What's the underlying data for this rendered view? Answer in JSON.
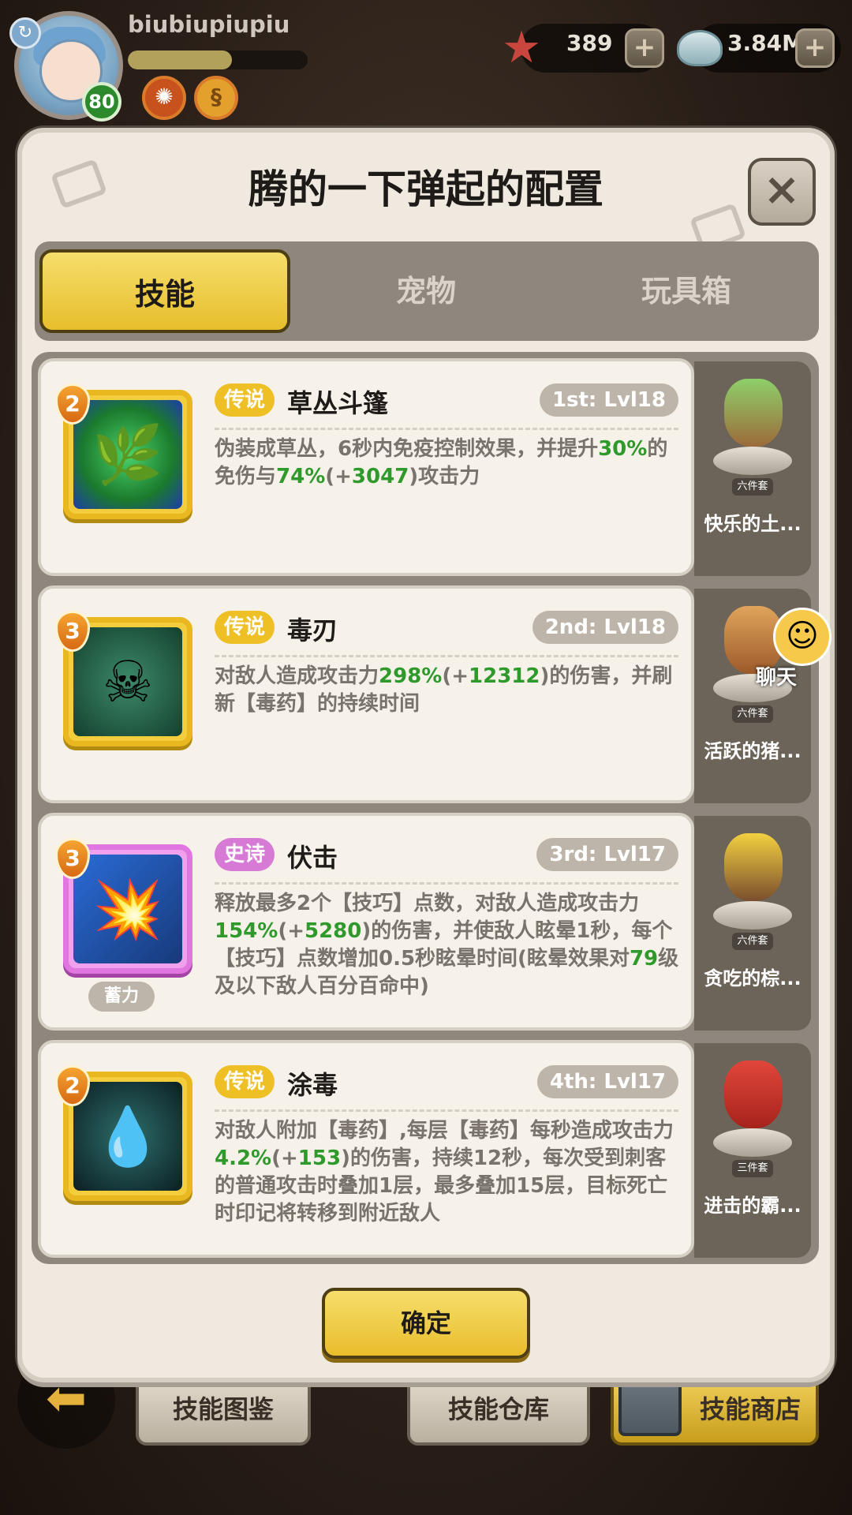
{
  "player": {
    "name": "biubiupiupiu",
    "level": "80",
    "xp_fraction": 0.58
  },
  "currency": {
    "starfish": "389",
    "shells": "3.84M"
  },
  "dialog": {
    "title": "腾的一下弹起的配置",
    "close_label": "×",
    "tabs": [
      "技能",
      "宠物",
      "玩具箱"
    ],
    "confirm_label": "确定"
  },
  "skills": [
    {
      "rarity": "传说",
      "name": "草丛斗篷",
      "slot": "1st: Lvl18",
      "stars": "2",
      "desc": [
        {
          "t": "伪装成草丛，6秒内免疫控制效果，并提升",
          "g": false
        },
        {
          "t": "30%",
          "g": true
        },
        {
          "t": "的免伤与",
          "g": false
        },
        {
          "t": "74%",
          "g": true
        },
        {
          "t": "(+",
          "g": false
        },
        {
          "t": "3047",
          "g": true
        },
        {
          "t": ")攻击力",
          "g": false
        }
      ]
    },
    {
      "rarity": "传说",
      "name": "毒刃",
      "slot": "2nd: Lvl18",
      "stars": "3",
      "desc": [
        {
          "t": "对敌人造成攻击力",
          "g": false
        },
        {
          "t": "298%",
          "g": true
        },
        {
          "t": "(+",
          "g": false
        },
        {
          "t": "12312",
          "g": true
        },
        {
          "t": ")的伤害，并刷新【毒药】的持续时间",
          "g": false
        }
      ]
    },
    {
      "rarity": "史诗",
      "name": "伏击",
      "slot": "3rd: Lvl17",
      "stars": "3",
      "charge": "蓄力",
      "desc": [
        {
          "t": "释放最多2个【技巧】点数，对敌人造成攻击力",
          "g": false
        },
        {
          "t": "154%",
          "g": true
        },
        {
          "t": "(+",
          "g": false
        },
        {
          "t": "5280",
          "g": true
        },
        {
          "t": ")的伤害，并使敌人眩晕1秒，每个【技巧】点数增加0.5秒眩晕时间(眩晕效果对",
          "g": false
        },
        {
          "t": "79",
          "g": true
        },
        {
          "t": "级及以下敌人百分百命中)",
          "g": false
        }
      ]
    },
    {
      "rarity": "传说",
      "name": "涂毒",
      "slot": "4th: Lvl17",
      "stars": "2",
      "desc": [
        {
          "t": "对敌人附加【毒药】,每层【毒药】每秒造成攻击力",
          "g": false
        },
        {
          "t": "4.2%",
          "g": true
        },
        {
          "t": "(+",
          "g": false
        },
        {
          "t": "153",
          "g": true
        },
        {
          "t": ")的伤害，持续12秒，每次受到刺客的普通攻击时叠加1层，最多叠加15层，目标死亡时印记将转移到附近敌人",
          "g": false
        }
      ]
    }
  ],
  "pets": [
    {
      "name": "快乐的土...",
      "tag": "六件套"
    },
    {
      "name": "活跃的猪...",
      "tag": "六件套"
    },
    {
      "name": "贪吃的棕...",
      "tag": "六件套"
    },
    {
      "name": "进击的霸...",
      "tag": "三件套"
    }
  ],
  "chat": {
    "label": "聊天"
  },
  "bottom_bar": {
    "buttons": [
      "技能图鉴",
      "技能仓库",
      "技能商店"
    ]
  },
  "colors": {
    "accent_yellow": "#efbf26",
    "epic_pink": "#d77ad6",
    "value_green": "#2f9a2b"
  }
}
